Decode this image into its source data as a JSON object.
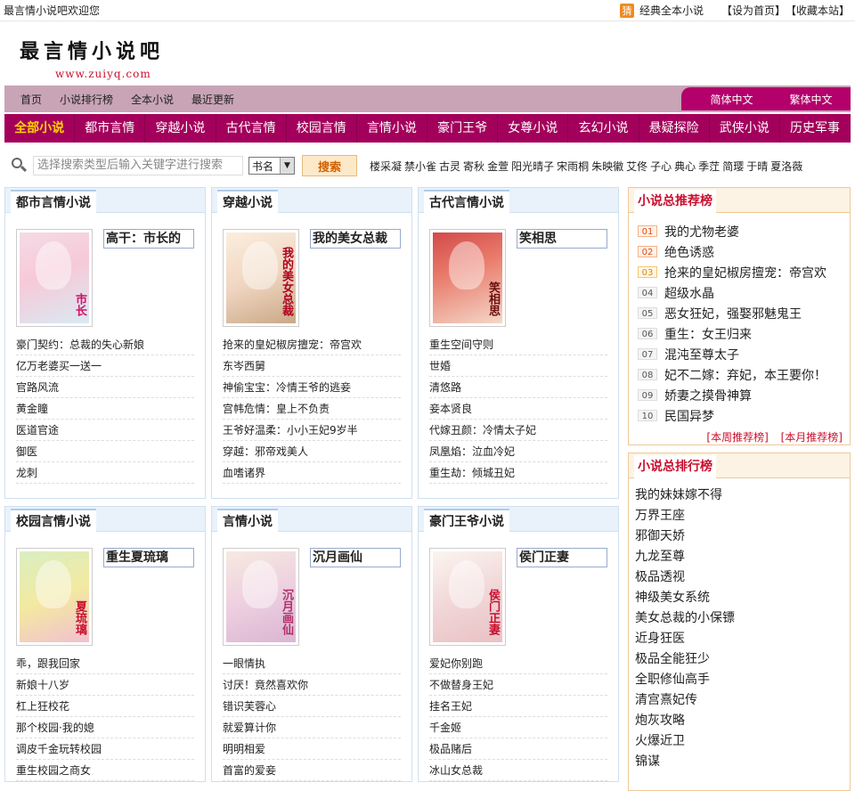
{
  "topbar": {
    "welcome": "最言情小说吧欢迎您",
    "hot_badge": "猜",
    "hot_link": "经典全本小说",
    "set_home": "【设为首页】",
    "bookmark": "【收藏本站】"
  },
  "logo": {
    "name": "最言情小说吧",
    "url": "www.zuiyq.com"
  },
  "nav1": {
    "links": [
      "首页",
      "小说排行榜",
      "全本小说",
      "最近更新"
    ],
    "lang_simple": "简体中文",
    "lang_traditional": "繁体中文"
  },
  "nav2": [
    "全部小说",
    "都市言情",
    "穿越小说",
    "古代言情",
    "校园言情",
    "言情小说",
    "豪门王爷",
    "女尊小说",
    "玄幻小说",
    "悬疑探险",
    "武侠小说",
    "历史军事"
  ],
  "search": {
    "placeholder": "选择搜索类型后输入关键字进行搜索",
    "select_value": "书名",
    "button": "搜索"
  },
  "authors": [
    "楼采凝",
    "禁小雀",
    "古灵",
    "寄秋",
    "金萱",
    "阳光晴子",
    "宋雨桐",
    "朱映徽",
    "艾佟",
    "子心",
    "典心",
    "季茳",
    "简璎",
    "于晴",
    "夏洛薇"
  ],
  "boxes": [
    {
      "title": "都市言情小说",
      "featured": "高干：市长的",
      "cover_text": "市长",
      "list": [
        "豪门契约：总裁的失心新娘",
        "亿万老婆买一送一",
        "官路风流",
        "黄金瞳",
        "医道官途",
        "御医",
        "龙刺"
      ]
    },
    {
      "title": "穿越小说",
      "featured": "我的美女总裁",
      "cover_text": "我的美女总裁",
      "list": [
        "抢来的皇妃椒房擅宠：帝宫欢",
        "东岑西舅",
        "神偷宝宝：冷情王爷的逃妾",
        "宫帏危情：皇上不负责",
        "王爷好温柔：小小王妃9岁半",
        "穿越：邪帝戏美人",
        "血嗜诸界"
      ]
    },
    {
      "title": "古代言情小说",
      "featured": "笑相思",
      "cover_text": "笑相思",
      "list": [
        "重生空间守则",
        "世婚",
        "清悠路",
        "妾本贤良",
        "代嫁丑颜：冷情太子妃",
        "凤凰焰：泣血冷妃",
        "重生劫：倾城丑妃"
      ]
    },
    {
      "title": "校园言情小说",
      "featured": "重生夏琉璃",
      "cover_text": "夏琉璃",
      "list": [
        "乖，跟我回家",
        "新娘十八岁",
        "杠上狂校花",
        "那个校园·我的媳",
        "调皮千金玩转校园",
        "重生校园之商女"
      ]
    },
    {
      "title": "言情小说",
      "featured": "沉月画仙",
      "cover_text": "沉月画仙",
      "list": [
        "一眼情执",
        "讨厌！竟然喜欢你",
        "错识芙蓉心",
        "就爱算计你",
        "明明相爱",
        "首富的爱妾"
      ]
    },
    {
      "title": "豪门王爷小说",
      "featured": "侯门正妻",
      "cover_text": "侯门正妻",
      "list": [
        "爱妃你别跑",
        "不做替身王妃",
        "挂名王妃",
        "千金姬",
        "极品赌后",
        "冰山女总裁"
      ]
    }
  ],
  "recommend": {
    "title": "小说总推荐榜",
    "items": [
      {
        "num": "01",
        "text": "我的尤物老婆"
      },
      {
        "num": "02",
        "text": "绝色诱惑"
      },
      {
        "num": "03",
        "text": "抢来的皇妃椒房擅宠：帝宫欢"
      },
      {
        "num": "04",
        "text": "超级水晶"
      },
      {
        "num": "05",
        "text": "恶女狂妃，强娶邪魅鬼王"
      },
      {
        "num": "06",
        "text": "重生：女王归来"
      },
      {
        "num": "07",
        "text": "混沌至尊太子"
      },
      {
        "num": "08",
        "text": "妃不二嫁：弃妃，本王要你！"
      },
      {
        "num": "09",
        "text": "娇妻之摸骨神算"
      },
      {
        "num": "10",
        "text": "民国异梦"
      }
    ],
    "week": "[本周推荐榜]",
    "month": "[本月推荐榜]"
  },
  "ranking": {
    "title": "小说总排行榜",
    "items": [
      "我的妹妹嫁不得",
      "万界王座",
      "邪御天娇",
      "九龙至尊",
      "极品透视",
      "神级美女系统",
      "美女总裁的小保镖",
      "近身狂医",
      "极品全能狂少",
      "全职修仙高手",
      "清宫熹妃传",
      "炮灰攻略",
      "火爆近卫",
      "锦谋"
    ]
  },
  "colors": {
    "nav_dark": "#a3005c",
    "nav_light": "#c8a4b6",
    "accent_red": "#c8102e",
    "active_nav": "#ffd200"
  }
}
